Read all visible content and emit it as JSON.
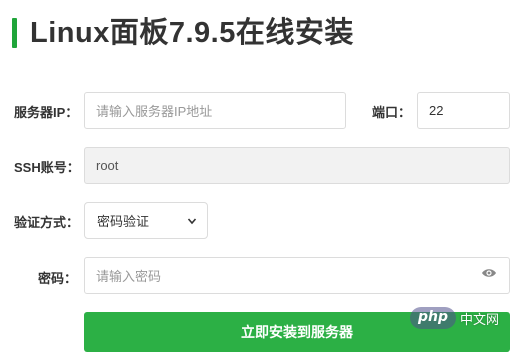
{
  "page": {
    "title": "Linux面板7.9.5在线安装",
    "accent_color": "#20a53a"
  },
  "form": {
    "server_ip": {
      "label": "服务器IP：",
      "placeholder": "请输入服务器IP地址",
      "value": ""
    },
    "port": {
      "label": "端口：",
      "value": "22"
    },
    "ssh_account": {
      "label": "SSH账号：",
      "value": "root"
    },
    "auth_method": {
      "label": "验证方式：",
      "selected": "密码验证"
    },
    "password": {
      "label": "密码：",
      "placeholder": "请输入密码",
      "icon": "eye-icon"
    },
    "submit_label": "立即安装到服务器"
  },
  "watermark": {
    "logo": "php",
    "text": "中文网"
  }
}
